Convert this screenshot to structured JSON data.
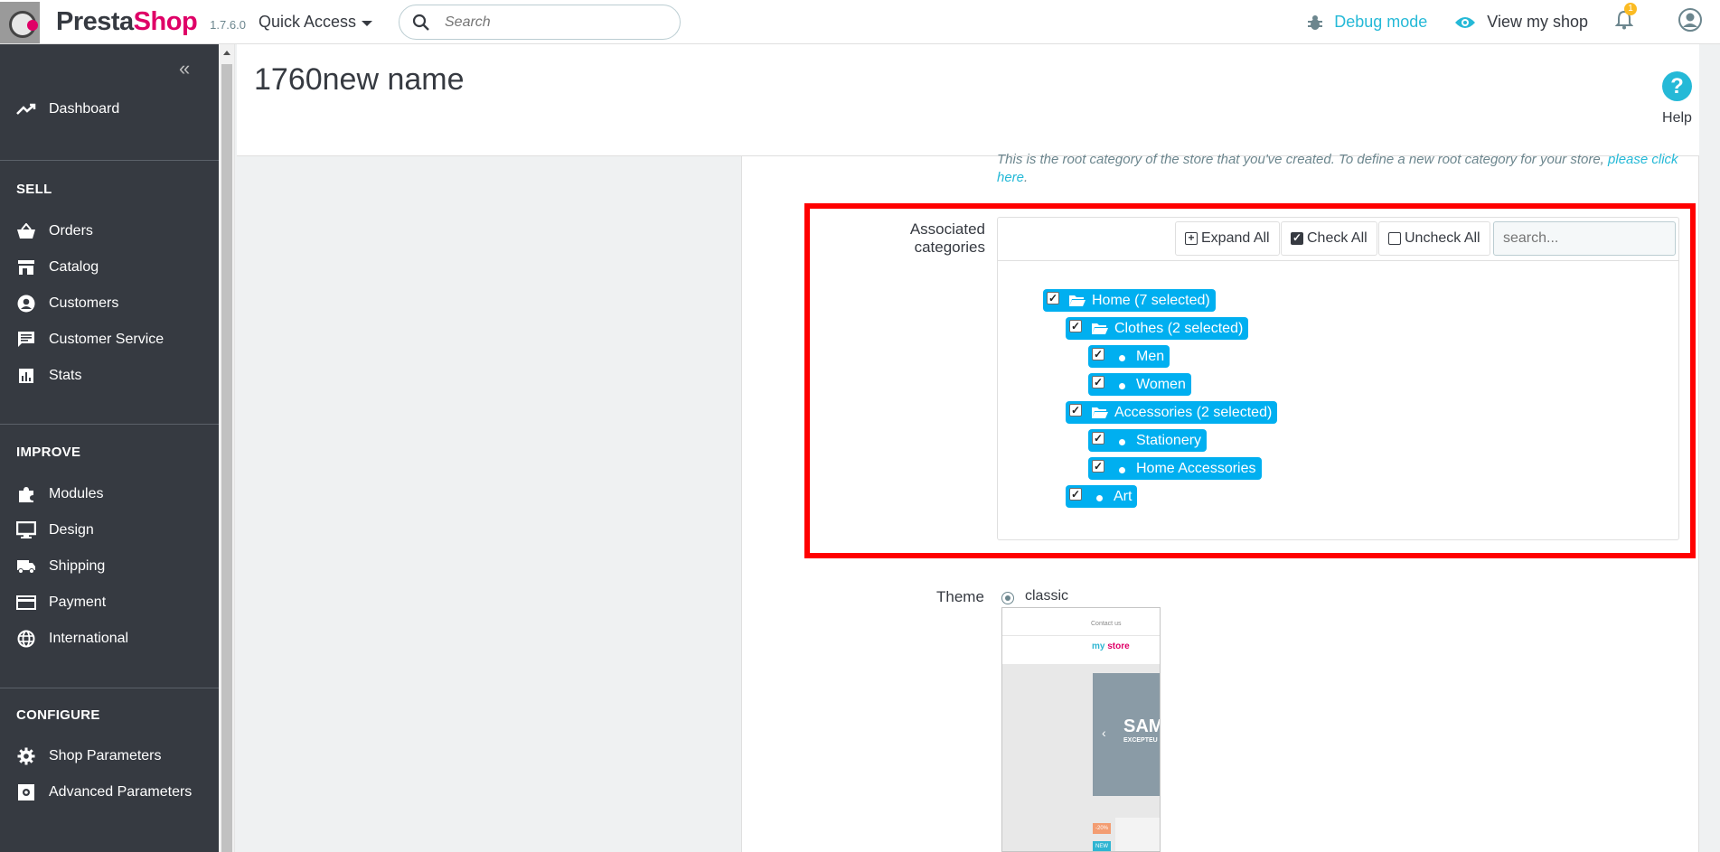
{
  "header": {
    "logo_text_a": "Presta",
    "logo_text_b": "Shop",
    "version": "1.7.6.0",
    "quick_access": "Quick Access",
    "search_placeholder": "Search",
    "debug_mode": "Debug mode",
    "view_my_shop": "View my shop",
    "notification_count": "1"
  },
  "sidebar": {
    "dashboard": "Dashboard",
    "sell_title": "SELL",
    "sell_items": [
      "Orders",
      "Catalog",
      "Customers",
      "Customer Service",
      "Stats"
    ],
    "improve_title": "IMPROVE",
    "improve_items": [
      "Modules",
      "Design",
      "Shipping",
      "Payment",
      "International"
    ],
    "configure_title": "CONFIGURE",
    "configure_items": [
      "Shop Parameters",
      "Advanced Parameters"
    ]
  },
  "page": {
    "title": "1760new name",
    "help": "Help",
    "root_note": "This is the root category of the store that you've created. To define a new root category for your store,",
    "root_note_link": "please click here",
    "root_note_end": "."
  },
  "categories": {
    "label": "Associated categories",
    "expand_all": "Expand All",
    "check_all": "Check All",
    "uncheck_all": "Uncheck All",
    "search_placeholder": "search...",
    "tree": [
      {
        "label": "Home (7 selected)",
        "type": "folder",
        "checked": true
      },
      {
        "label": "Clothes (2 selected)",
        "type": "folder",
        "checked": true
      },
      {
        "label": "Men",
        "type": "leaf",
        "checked": true
      },
      {
        "label": "Women",
        "type": "leaf",
        "checked": true
      },
      {
        "label": "Accessories (2 selected)",
        "type": "folder",
        "checked": true
      },
      {
        "label": "Stationery",
        "type": "leaf",
        "checked": true
      },
      {
        "label": "Home Accessories",
        "type": "leaf",
        "checked": true
      },
      {
        "label": "Art",
        "type": "leaf",
        "checked": true
      }
    ]
  },
  "theme": {
    "label": "Theme",
    "selected": "classic",
    "preview": {
      "contact": "Contact us",
      "brand_a": "my ",
      "brand_b": "store",
      "slide_title": "SAM",
      "slide_sub": "EXCEPTEU",
      "tag_sale": "-20%",
      "tag_new": "NEW"
    }
  },
  "colors": {
    "accent": "#25b9d7",
    "sidebar_bg": "#363a41",
    "tree_node": "#00aff0",
    "highlight": "#ff0000",
    "brand_pink": "#df0067"
  }
}
